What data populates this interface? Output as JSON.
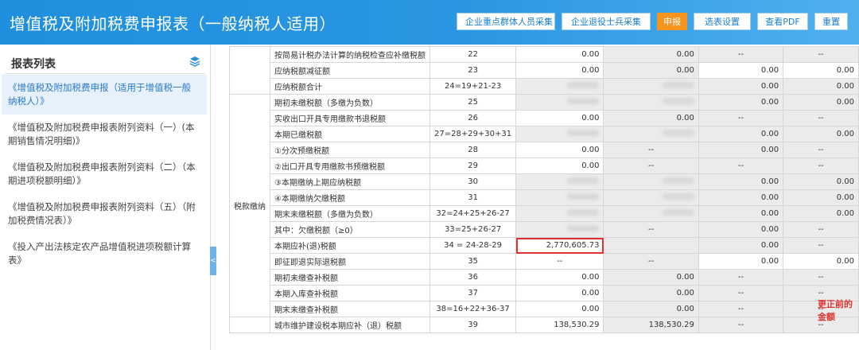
{
  "header": {
    "title": "增值税及附加税费申报表（一般纳税人适用）",
    "buttons": [
      "企业重点群体人员采集",
      "企业退役士兵采集",
      "申报",
      "选表设置",
      "查看PDF",
      "重置"
    ]
  },
  "sidebar": {
    "title": "报表列表",
    "items": [
      {
        "label": "《增值税及附加税费申报（适用于增值税一般纳税人）》",
        "active": true
      },
      {
        "label": "《增值税及附加税费申报表附列资料（一）(本期销售情况明细)》",
        "active": false
      },
      {
        "label": "《增值税及附加税费申报表附列资料（二）（本期进项税额明细）》",
        "active": false
      },
      {
        "label": "《增值税及附加税费申报表附列资料（五）（附加税费情况表）》",
        "active": false
      },
      {
        "label": "《投入产出法核定农产品增值税进项税额计算表》",
        "active": false
      }
    ]
  },
  "table": {
    "section_label": "税款缴纳",
    "rows": [
      {
        "name": "按简易计税办法计算的纳税检查应补缴税额",
        "no": "22",
        "a": "0.00",
        "b": "0.00",
        "c": "--",
        "d": "--"
      },
      {
        "name": "应纳税额减征额",
        "no": "23",
        "a": "0.00",
        "b": "0.00",
        "c": "0.00",
        "d": "0.00"
      },
      {
        "name": "应纳税额合计",
        "no": "24=19+21-23",
        "a": "",
        "b": "",
        "c": "0.00",
        "d": "0.00"
      },
      {
        "name": "期初未缴税额（多缴为负数）",
        "no": "25",
        "a": "",
        "b": "",
        "c": "0.00",
        "d": "0.00"
      },
      {
        "name": "实收出口开具专用缴款书退税额",
        "no": "26",
        "a": "0.00",
        "b": "0.00",
        "c": "--",
        "d": "--"
      },
      {
        "name": "本期已缴税额",
        "no": "27=28+29+30+31",
        "a": "",
        "b": "",
        "c": "0.00",
        "d": "0.00"
      },
      {
        "name": "①分次预缴税额",
        "no": "28",
        "a": "0.00",
        "b": "--",
        "c": "0.00",
        "d": "--"
      },
      {
        "name": "②出口开具专用缴款书预缴税额",
        "no": "29",
        "a": "0.00",
        "b": "--",
        "c": "--",
        "d": "--"
      },
      {
        "name": "③本期缴纳上期应纳税额",
        "no": "30",
        "a": "",
        "b": "",
        "c": "0.00",
        "d": "0.00"
      },
      {
        "name": "④本期缴纳欠缴税额",
        "no": "31",
        "a": "",
        "b": "",
        "c": "0.00",
        "d": "0.00"
      },
      {
        "name": "期末未缴税额（多缴为负数）",
        "no": "32=24+25+26-27",
        "a": "",
        "b": "",
        "c": "0.00",
        "d": "0.00"
      },
      {
        "name": "其中：欠缴税额（≥0）",
        "no": "33=25+26-27",
        "a": "",
        "b": "--",
        "c": "0.00",
        "d": "--"
      },
      {
        "name": "本期应补(退)税额",
        "no": "34 = 24-28-29",
        "a": "2,770,605.73",
        "b": "",
        "c": "0.00",
        "d": "--"
      },
      {
        "name": "即征即退实际退税额",
        "no": "35",
        "a": "--",
        "b": "--",
        "c": "0.00",
        "d": "0.00"
      },
      {
        "name": "期初未缴查补税额",
        "no": "36",
        "a": "0.00",
        "b": "0.00",
        "c": "--",
        "d": "--"
      },
      {
        "name": "本期入库查补税额",
        "no": "37",
        "a": "0.00",
        "b": "0.00",
        "c": "--",
        "d": "--"
      },
      {
        "name": "期末未缴查补税额",
        "no": "38=16+22+36-37",
        "a": "0.00",
        "b": "0.00",
        "c": "--",
        "d": "--"
      },
      {
        "name": "城市维护建设税本期应补（退）税额",
        "no": "39",
        "a": "138,530.29",
        "b": "138,530.29",
        "c": "--",
        "d": "--"
      }
    ]
  },
  "annotation": "更正前的金额",
  "colors": {
    "header_blue": "#2b97e3",
    "accent_orange": "#f7941d",
    "red": "#e03232"
  }
}
